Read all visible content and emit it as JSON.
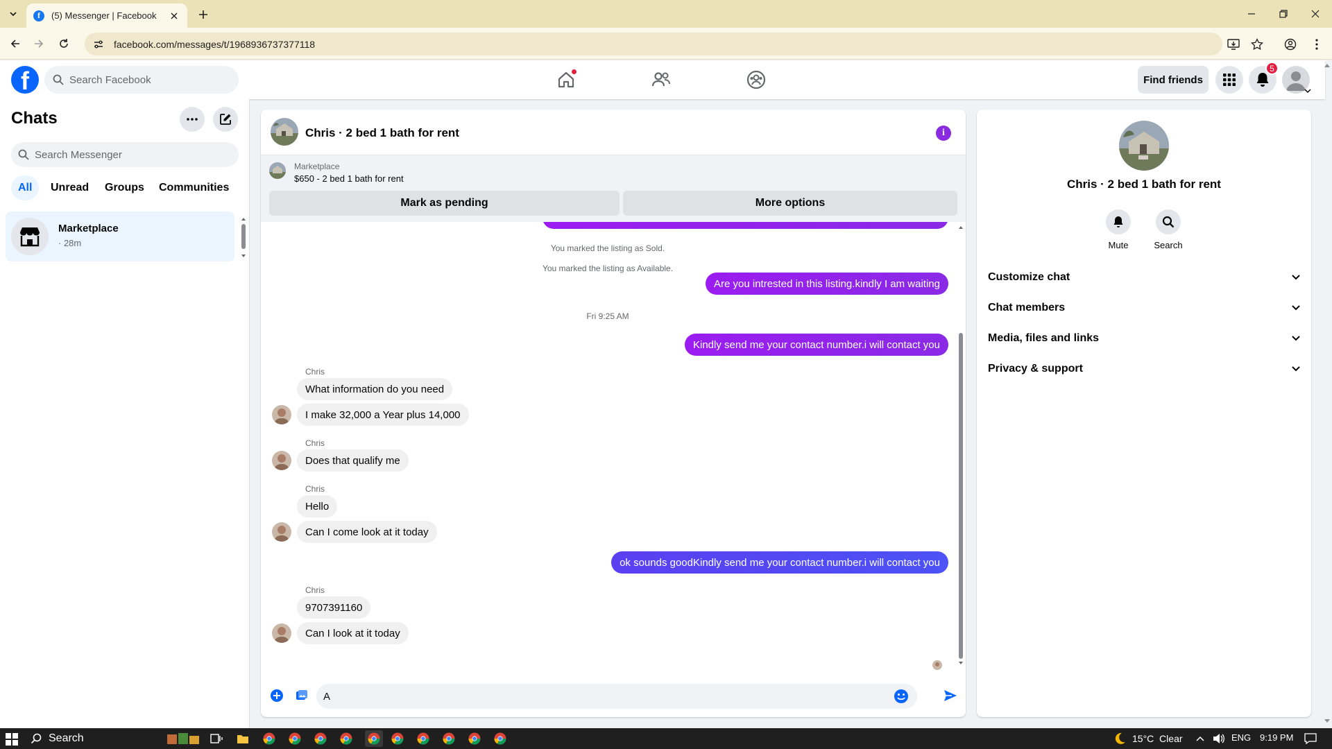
{
  "browser": {
    "tab_title": "(5) Messenger | Facebook",
    "url": "facebook.com/messages/t/1968936737377118"
  },
  "facebook": {
    "search_placeholder": "Search Facebook",
    "find_friends_label": "Find friends",
    "notification_count": "5"
  },
  "sidebar": {
    "title": "Chats",
    "search_placeholder": "Search Messenger",
    "filters": [
      "All",
      "Unread",
      "Groups",
      "Communities"
    ],
    "active_filter": "All",
    "chats": [
      {
        "name": "Marketplace",
        "time": "· 28m"
      }
    ]
  },
  "chat": {
    "title": "Chris · 2 bed 1 bath for rent",
    "listing": {
      "source": "Marketplace",
      "price_title": "$650 - 2 bed 1 bath for rent",
      "mark_pending_label": "Mark as pending",
      "more_options_label": "More options"
    },
    "messages": [
      {
        "type": "system",
        "text": "You marked the listing as Sold."
      },
      {
        "type": "system",
        "text": "You marked the listing as Available."
      },
      {
        "type": "out",
        "text": "Are you intrested in this listing.kindly I am waiting"
      },
      {
        "type": "timestamp",
        "text": "Fri 9:25 AM"
      },
      {
        "type": "out",
        "text": "Kindly send me your contact number.i will contact you"
      },
      {
        "type": "sender",
        "text": "Chris"
      },
      {
        "type": "in",
        "text": "What information do you need"
      },
      {
        "type": "in",
        "text": "I  make 32,000 a Year plus 14,000"
      },
      {
        "type": "sender",
        "text": "Chris"
      },
      {
        "type": "in",
        "text": "Does that qualify me"
      },
      {
        "type": "sender",
        "text": "Chris"
      },
      {
        "type": "in",
        "text": "Hello"
      },
      {
        "type": "in",
        "text": "Can I come look at it today"
      },
      {
        "type": "out",
        "text": "ok sounds goodKindly send me your contact number.i will contact you"
      },
      {
        "type": "sender",
        "text": "Chris"
      },
      {
        "type": "in",
        "text": "9707391160"
      },
      {
        "type": "in",
        "text": "Can I look at it today"
      }
    ],
    "composer_value": "A"
  },
  "info_panel": {
    "name": "Chris · 2 bed 1 bath for rent",
    "actions": [
      "Mute",
      "Search"
    ],
    "sections": [
      "Customize chat",
      "Chat members",
      "Media, files and links",
      "Privacy & support"
    ]
  },
  "taskbar": {
    "search_label": "Search",
    "weather": "15°C  Clear",
    "language": "ENG",
    "time": "9:19 PM"
  },
  "colors": {
    "outgoing_bubble": "#9b1cf0",
    "outgoing_bubble_blue": "#4c52f5",
    "facebook_blue": "#0866ff",
    "notification_red": "#e41e3f"
  }
}
